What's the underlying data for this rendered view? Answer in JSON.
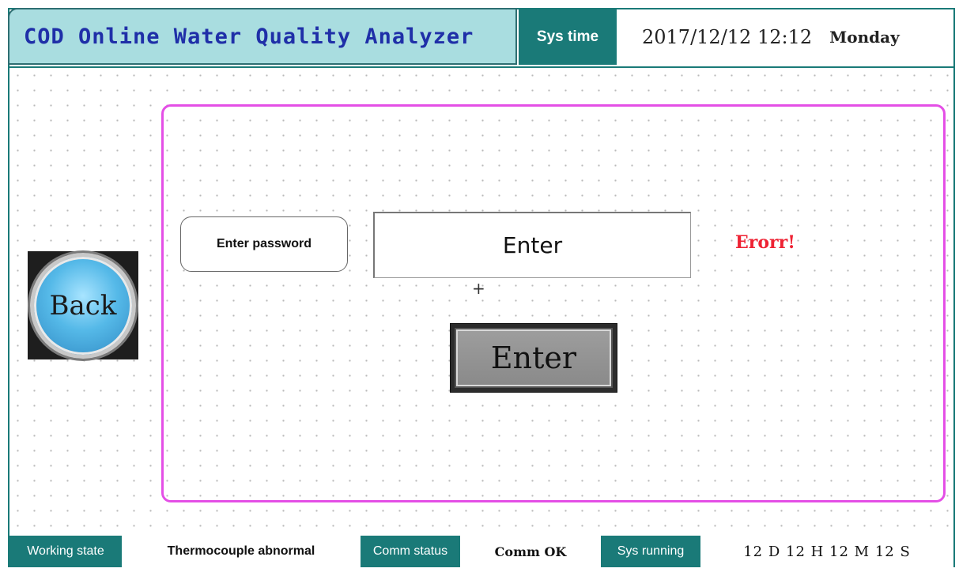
{
  "header": {
    "title": "COD Online Water Quality Analyzer",
    "sys_time_label": "Sys time",
    "sys_time_date": "2017/12/12 12:12",
    "sys_time_day": "Monday"
  },
  "main": {
    "back_label": "Back",
    "password_label": "Enter password",
    "password_input_value": "Enter",
    "cursor_glyph": "+",
    "error_text": "Erorr!",
    "enter_button_label": "Enter"
  },
  "footer": {
    "working_state_label": "Working state",
    "working_state_value": "Thermocouple abnormal",
    "comm_status_label": "Comm status",
    "comm_status_value": "Comm OK",
    "sys_running_label": "Sys running",
    "sys_running_value": "12 D 12 H 12 M 12 S"
  },
  "colors": {
    "teal": "#1a7a78",
    "title_bg": "#a9dde0",
    "title_text": "#1f2fa8",
    "panel_border": "#e44fe6",
    "error": "#ee2233"
  }
}
